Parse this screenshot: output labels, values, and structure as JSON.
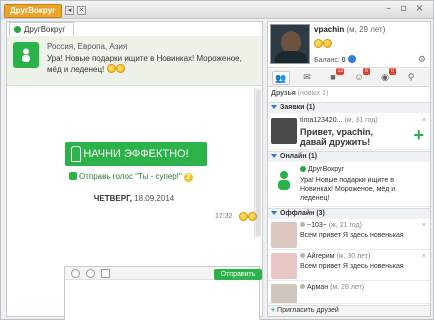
{
  "window": {
    "logo_label": "ДругВокруг",
    "toolbar_icons": [
      "sound-icon",
      "mute-icon"
    ],
    "controls": [
      "minimize",
      "maximize",
      "close"
    ]
  },
  "chat": {
    "tab_label": "ДругВокруг",
    "header": {
      "location": "Россия, Европа, Азия",
      "message": "Ура! Новые подарки ищите в Новинках! Мороженое, мёд и леденец!"
    },
    "promo_label": "НАЧНИ ЭФФЕКТНО!",
    "vote_label": "Отправь голос \"Ты - супер!\"",
    "vote_count": "2",
    "date_day": "ЧЕТВЕРГ,",
    "date_value": "18.09.2014",
    "message_time": "17:32",
    "send_label": "Отправить"
  },
  "profile": {
    "name": "vpachin",
    "meta": "(м, 29 лет)",
    "balance_label": "Баланс:",
    "balance_value": "0"
  },
  "tabs": [
    {
      "icon": "people-icon",
      "active": true,
      "count": ""
    },
    {
      "icon": "mail-icon",
      "active": false,
      "count": ""
    },
    {
      "icon": "gift-icon",
      "active": false,
      "count": "13"
    },
    {
      "icon": "smiles-icon",
      "active": false,
      "count": "6"
    },
    {
      "icon": "contacts-icon",
      "active": false,
      "count": "0"
    },
    {
      "icon": "search-icon",
      "active": false,
      "count": ""
    }
  ],
  "friends": {
    "title": "Друзья",
    "new_count": "(новых 1)",
    "requests_header": "Заявки (1)",
    "requests": [
      {
        "name": "tima123420...",
        "meta": "(м, 31 год)",
        "text": "Привет, vpachin, давай дружить!"
      }
    ],
    "online_header": "Онлайн (1)",
    "online": [
      {
        "name": "ДругВокруг",
        "text": "Ура! Новые подарки ищите в Новинках! Мороженое, мёд и леденец!"
      }
    ],
    "offline_header": "Оффлайн (3)",
    "offline": [
      {
        "name": "~103~",
        "meta": "(ж, 21 год)",
        "text": "Всем привет Я здесь новенькая"
      },
      {
        "name": "Айгерим",
        "meta": "(ж, 30 лет)",
        "text": "Всем привет Я здесь новенькая"
      },
      {
        "name": "Арман",
        "meta": "(м, 28 лет)",
        "text": ""
      }
    ],
    "invite_label": "Пригласить друзей"
  },
  "colors": {
    "accent_green": "#2bb34a",
    "logo_orange": "#e9a52a",
    "section_blue": "#2d77c8"
  }
}
